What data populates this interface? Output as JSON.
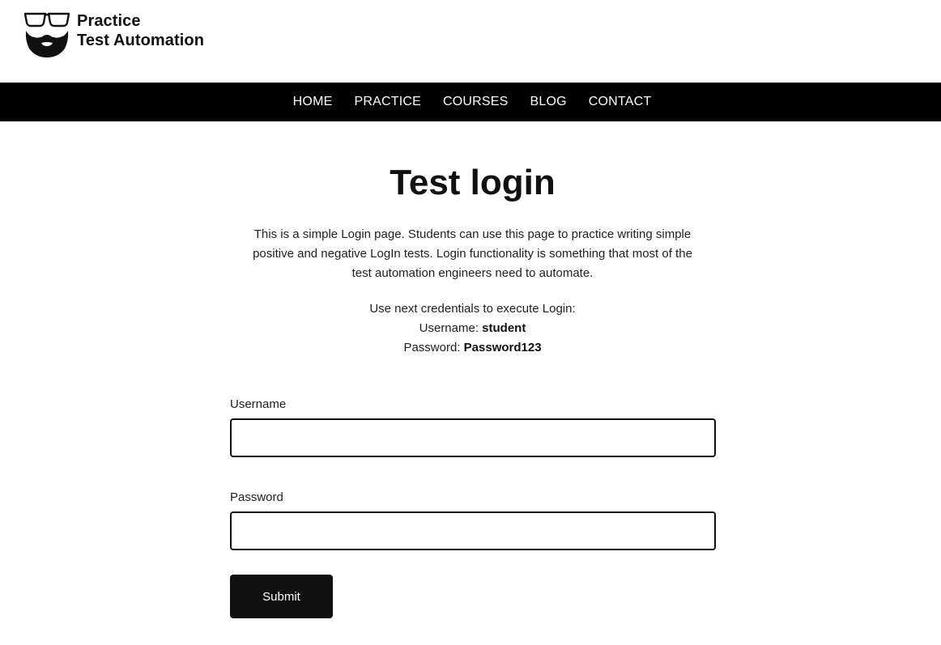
{
  "brand": {
    "line1": "Practice",
    "line2": "Test Automation",
    "logo_icon": "bearded-face-glasses-icon"
  },
  "nav": {
    "items": [
      {
        "label": "HOME"
      },
      {
        "label": "PRACTICE"
      },
      {
        "label": "COURSES"
      },
      {
        "label": "BLOG"
      },
      {
        "label": "CONTACT"
      }
    ]
  },
  "page": {
    "title": "Test login",
    "intro": "This is a simple Login page. Students can use this page to practice writing simple positive and negative LogIn tests. Login functionality is something that most of the test automation engineers need to automate.",
    "credentials": {
      "heading": "Use next credentials to execute Login:",
      "username_label": "Username: ",
      "username_value": "student",
      "password_label": "Password: ",
      "password_value": "Password123"
    }
  },
  "form": {
    "username": {
      "label": "Username",
      "value": ""
    },
    "password": {
      "label": "Password",
      "value": ""
    },
    "submit_label": "Submit"
  },
  "colors": {
    "navbar_bg": "#000000",
    "nav_text": "#ffffff",
    "button_bg": "#111111",
    "button_text": "#ffffff",
    "input_border": "#111111"
  }
}
